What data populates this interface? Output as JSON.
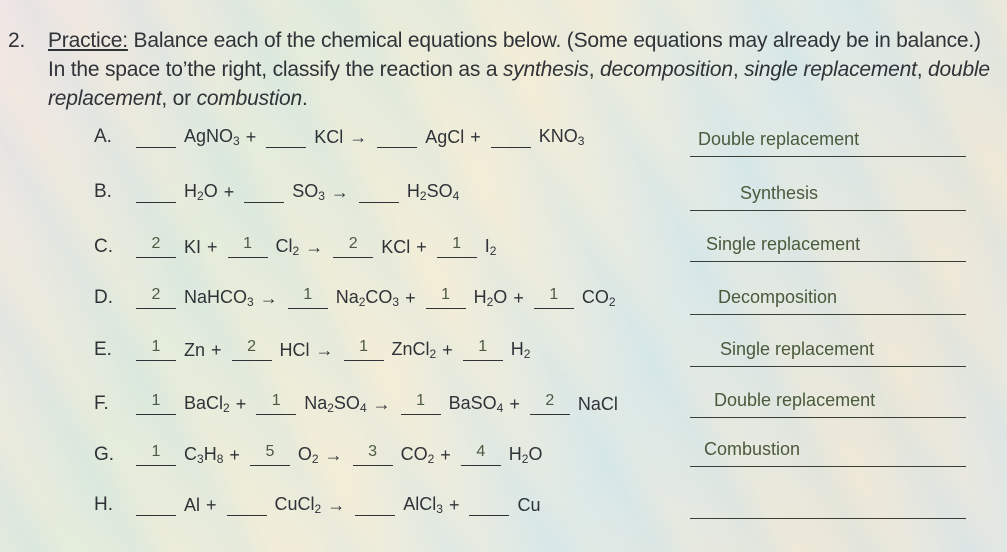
{
  "instruction": {
    "number": "2.",
    "label": "Practice:",
    "text_1": " Balance each of the chemical equations below. (Some equations may already be in balance.) In the space to’the right, classify the reaction as a ",
    "types_inline": [
      "synthesis",
      "decomposition",
      "single replacement",
      "double replacement",
      "combustion"
    ]
  },
  "arrow": "→",
  "plus": "+",
  "equations": [
    {
      "letter": "A.",
      "answer": "Double replacement",
      "terms": [
        {
          "coef": "",
          "formula": [
            "AgNO",
            "3"
          ]
        },
        {
          "coef": "",
          "formula": [
            "KCl"
          ]
        },
        {
          "coef": "",
          "formula": [
            "AgCl"
          ]
        },
        {
          "coef": "",
          "formula": [
            "KNO",
            "3"
          ]
        }
      ],
      "reactants": 2
    },
    {
      "letter": "B.",
      "answer": "Synthesis",
      "terms": [
        {
          "coef": "",
          "formula": [
            "H",
            "2",
            "O"
          ]
        },
        {
          "coef": "",
          "formula": [
            "SO",
            "3"
          ]
        },
        {
          "coef": "",
          "formula": [
            "H",
            "2",
            "SO",
            "4"
          ]
        }
      ],
      "reactants": 2
    },
    {
      "letter": "C.",
      "answer": "Single replacement",
      "terms": [
        {
          "coef": "2",
          "formula": [
            "KI"
          ]
        },
        {
          "coef": "1",
          "formula": [
            "Cl",
            "2"
          ]
        },
        {
          "coef": "2",
          "formula": [
            "KCl"
          ]
        },
        {
          "coef": "1",
          "formula": [
            "I",
            "2"
          ]
        }
      ],
      "reactants": 2
    },
    {
      "letter": "D.",
      "answer": "Decomposition",
      "terms": [
        {
          "coef": "2",
          "formula": [
            "NaHCO",
            "3"
          ]
        },
        {
          "coef": "1",
          "formula": [
            "Na",
            "2",
            "CO",
            "3"
          ]
        },
        {
          "coef": "1",
          "formula": [
            "H",
            "2",
            "O"
          ]
        },
        {
          "coef": "1",
          "formula": [
            "CO",
            "2"
          ]
        }
      ],
      "reactants": 1
    },
    {
      "letter": "E.",
      "answer": "Single replacement",
      "terms": [
        {
          "coef": "1",
          "formula": [
            "Zn"
          ]
        },
        {
          "coef": "2",
          "formula": [
            "HCl"
          ]
        },
        {
          "coef": "1",
          "formula": [
            "ZnCl",
            "2"
          ]
        },
        {
          "coef": "1",
          "formula": [
            "H",
            "2"
          ]
        }
      ],
      "reactants": 2
    },
    {
      "letter": "F.",
      "answer": "Double replacement",
      "terms": [
        {
          "coef": "1",
          "formula": [
            "BaCl",
            "2"
          ]
        },
        {
          "coef": "1",
          "formula": [
            "Na",
            "2",
            "SO",
            "4"
          ]
        },
        {
          "coef": "1",
          "formula": [
            "BaSO",
            "4"
          ]
        },
        {
          "coef": "2",
          "formula": [
            "NaCl"
          ]
        }
      ],
      "reactants": 2
    },
    {
      "letter": "G.",
      "answer": "Combustion",
      "terms": [
        {
          "coef": "1",
          "formula": [
            "C",
            "3",
            "H",
            "8"
          ]
        },
        {
          "coef": "5",
          "formula": [
            "O",
            "2"
          ]
        },
        {
          "coef": "3",
          "formula": [
            "CO",
            "2"
          ]
        },
        {
          "coef": "4",
          "formula": [
            "H",
            "2",
            "O"
          ]
        }
      ],
      "reactants": 2
    },
    {
      "letter": "H.",
      "answer": "",
      "terms": [
        {
          "coef": "",
          "formula": [
            "Al"
          ]
        },
        {
          "coef": "",
          "formula": [
            "CuCl",
            "2"
          ]
        },
        {
          "coef": "",
          "formula": [
            "AlCl",
            "3"
          ]
        },
        {
          "coef": "",
          "formula": [
            "Cu"
          ]
        }
      ],
      "reactants": 2
    }
  ]
}
